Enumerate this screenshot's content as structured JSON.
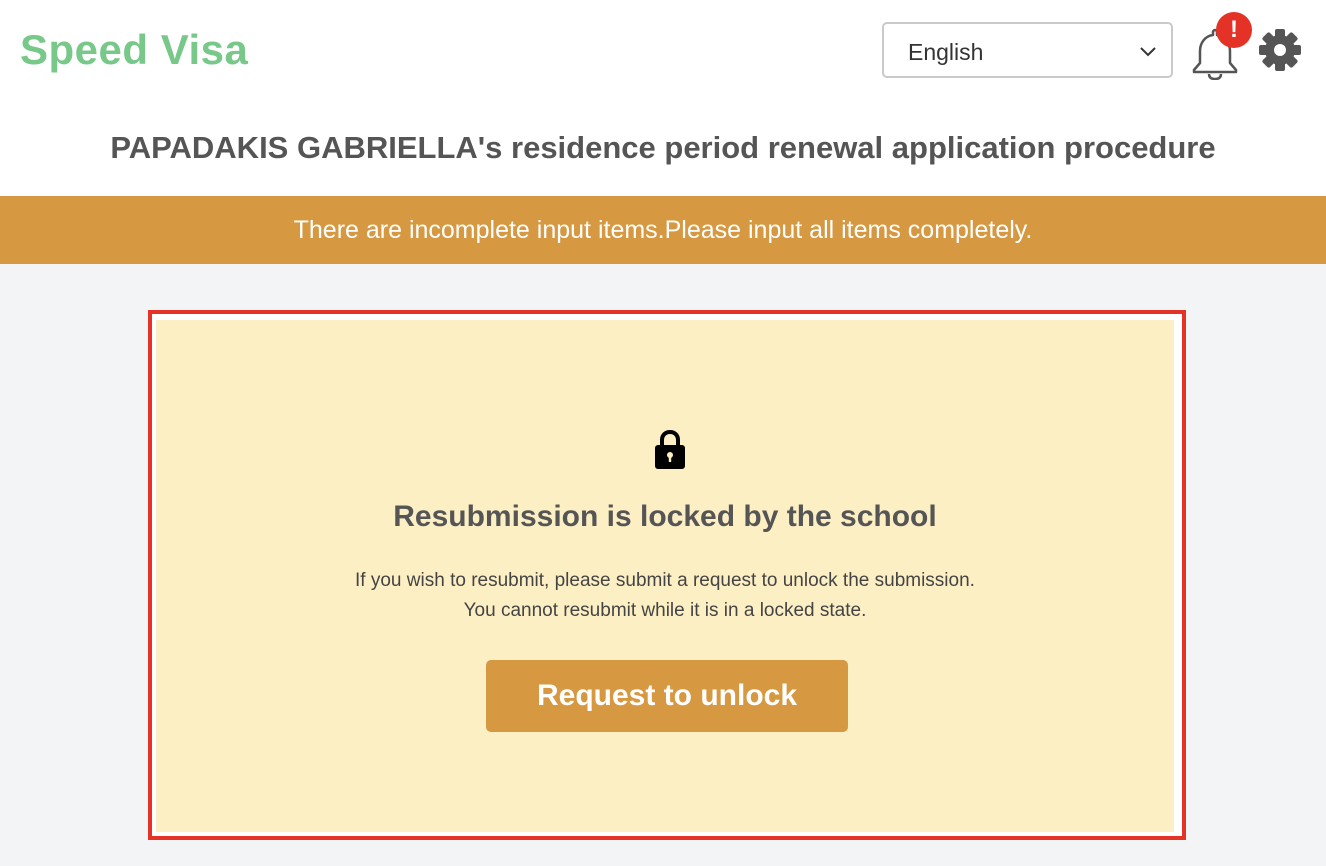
{
  "header": {
    "logo": "Speed Visa",
    "language": {
      "selected": "English"
    },
    "notifications": {
      "badge": "!"
    },
    "icons": {
      "bell": "bell-icon",
      "settings": "gear-icon",
      "dropdown": "chevron-down-icon"
    }
  },
  "page": {
    "title": "PAPADAKIS GABRIELLA's residence period renewal application procedure"
  },
  "banner": {
    "message": "There are incomplete input items.Please input all items completely."
  },
  "lock_panel": {
    "icon": "lock-icon",
    "heading": "Resubmission is locked by the school",
    "message_line1": "If you wish to resubmit, please submit a request to unlock the submission.",
    "message_line2": "You cannot resubmit while it is in a locked state.",
    "button_label": "Request to unlock"
  },
  "colors": {
    "brand": "#78c88a",
    "accent": "#d69840",
    "alert": "#e53226",
    "panel_bg": "#fdefc4"
  }
}
